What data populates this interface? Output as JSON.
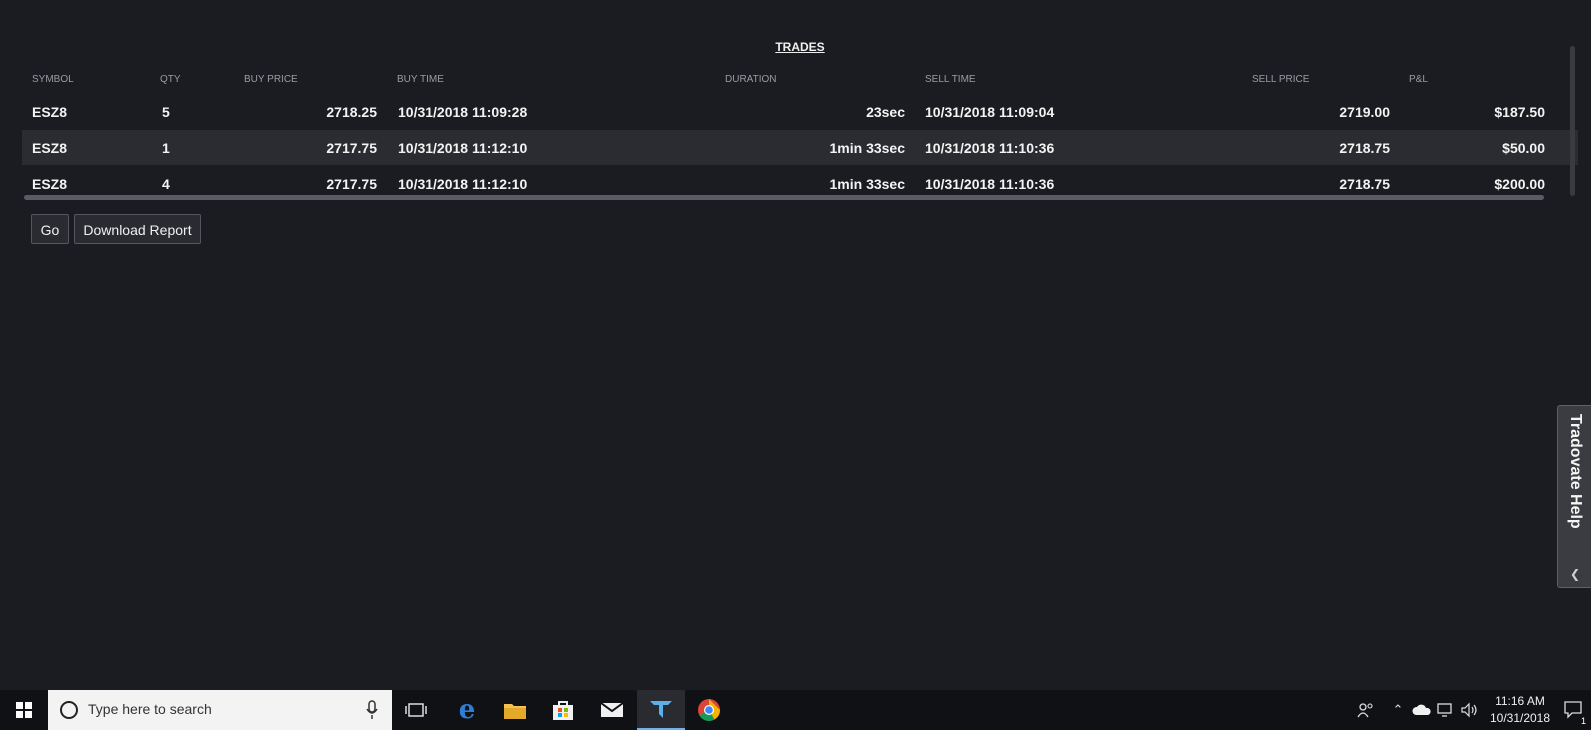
{
  "title": "TRADES",
  "columns": [
    {
      "key": "symbol",
      "label": "SYMBOL"
    },
    {
      "key": "qty",
      "label": "QTY"
    },
    {
      "key": "buy_price",
      "label": "BUY PRICE"
    },
    {
      "key": "buy_time",
      "label": "BUY TIME"
    },
    {
      "key": "duration",
      "label": "DURATION"
    },
    {
      "key": "sell_time",
      "label": "SELL TIME"
    },
    {
      "key": "sell_price",
      "label": "SELL PRICE"
    },
    {
      "key": "pnl",
      "label": "P&L"
    }
  ],
  "rows": [
    {
      "symbol": "ESZ8",
      "qty": "5",
      "buy_price": "2718.25",
      "buy_time": "10/31/2018 11:09:28",
      "duration": "23sec",
      "sell_time": "10/31/2018 11:09:04",
      "sell_price": "2719.00",
      "pnl": "$187.50"
    },
    {
      "symbol": "ESZ8",
      "qty": "1",
      "buy_price": "2717.75",
      "buy_time": "10/31/2018 11:12:10",
      "duration": "1min 33sec",
      "sell_time": "10/31/2018 11:10:36",
      "sell_price": "2718.75",
      "pnl": "$50.00"
    },
    {
      "symbol": "ESZ8",
      "qty": "4",
      "buy_price": "2717.75",
      "buy_time": "10/31/2018 11:12:10",
      "duration": "1min 33sec",
      "sell_time": "10/31/2018 11:10:36",
      "sell_price": "2718.75",
      "pnl": "$200.00"
    }
  ],
  "buttons": {
    "go": "Go",
    "download": "Download Report"
  },
  "help_tab": {
    "label": "Tradovate Help",
    "icon": "chevron-left-icon"
  },
  "taskbar": {
    "search_placeholder": "Type here to search",
    "time": "11:16 AM",
    "date": "10/31/2018",
    "notification_count": "1",
    "icons": [
      "windows-start-icon",
      "cortana-icon",
      "microphone-icon",
      "task-view-icon",
      "edge-icon",
      "file-explorer-icon",
      "store-icon",
      "mail-icon",
      "tradovate-icon",
      "chrome-icon",
      "people-icon",
      "chevron-up-icon",
      "onedrive-icon",
      "network-icon",
      "volume-icon",
      "action-center-icon"
    ]
  },
  "colors": {
    "background": "#1b1c21",
    "row_alt": "#2b2c32",
    "taskbar": "#101114",
    "accent": "#77aee0"
  }
}
